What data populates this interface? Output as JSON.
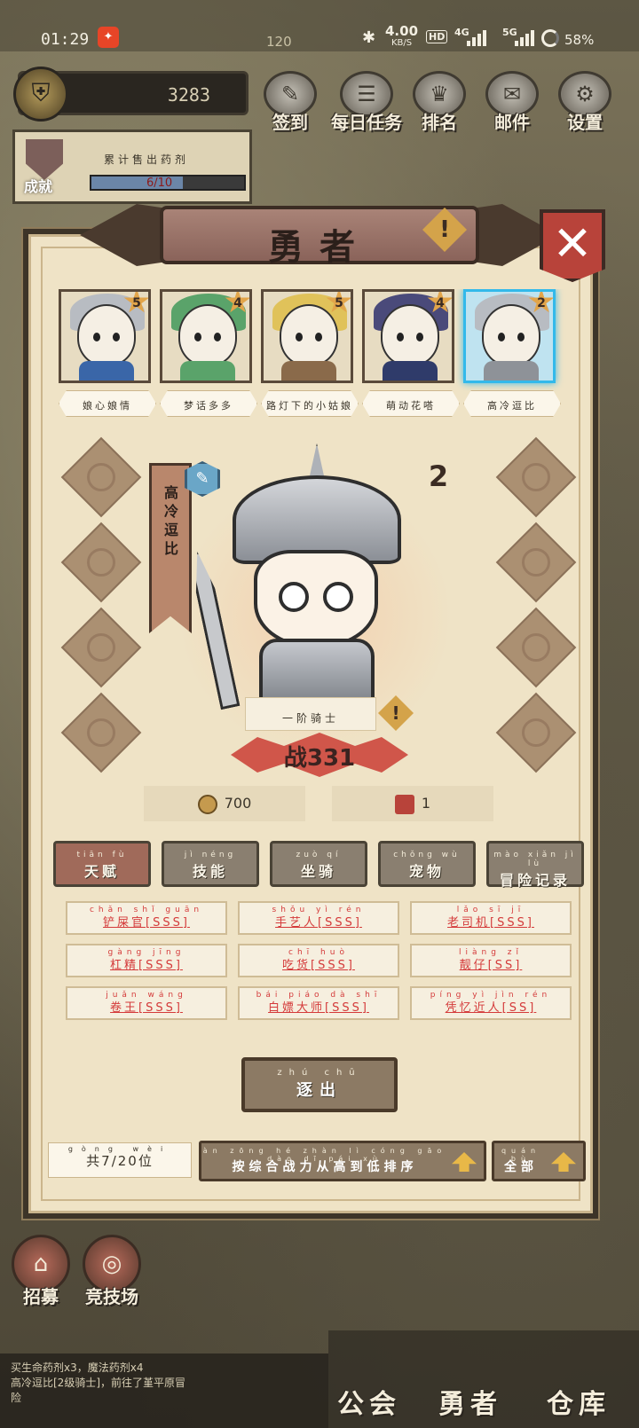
{
  "status_bar": {
    "time": "01:29",
    "app_icon_glyph": "✦",
    "resource_count": "120",
    "bluetooth_glyph": "✱",
    "net_speed": "4.00",
    "net_speed_unit": "KB/S",
    "hd_label": "HD",
    "signal_1": "4G",
    "signal_2": "5G",
    "battery_pct": "58%"
  },
  "hud": {
    "score": "3283",
    "achievement": {
      "label": "成就",
      "task_text": "累计售出药剂",
      "progress_text": "6/10",
      "progress": 0.6
    },
    "menu": [
      {
        "label": "签到",
        "icon": "quill-icon",
        "glyph": "✎"
      },
      {
        "label": "每日任务",
        "icon": "scroll-icon",
        "glyph": "☰"
      },
      {
        "label": "排名",
        "icon": "crown-icon",
        "glyph": "♛"
      },
      {
        "label": "邮件",
        "icon": "envelope-icon",
        "glyph": "✉"
      },
      {
        "label": "设置",
        "icon": "gear-icon",
        "glyph": "⚙"
      }
    ]
  },
  "panel": {
    "title": "勇者",
    "warn_glyph": "!",
    "close_glyph": "✕",
    "heroes": [
      {
        "name": "娘心娘情",
        "stars": "5",
        "hat": "#b8bcc2",
        "body": "#3a66a8",
        "selected": false
      },
      {
        "name": "梦话多多",
        "stars": "4",
        "hat": "#5aa36a",
        "body": "#5aa36a",
        "selected": false
      },
      {
        "name": "路灯下的小姑娘",
        "stars": "5",
        "hat": "#e0c25a",
        "body": "#8a6a4a",
        "selected": false
      },
      {
        "name": "萌动花嗒",
        "stars": "4",
        "hat": "#4a4a7a",
        "body": "#2f3b6a",
        "selected": false
      },
      {
        "name": "高冷逗比",
        "stars": "2",
        "hat": "#b8bcc2",
        "body": "#8e9298",
        "selected": true
      }
    ],
    "selected_hero": {
      "name_vertical": "高冷逗比",
      "rank": "2",
      "job": "一阶骑士",
      "power_prefix": "战",
      "power": "331",
      "cost_gold": "700",
      "cost_ticket": "1",
      "feather_glyph": "✎"
    },
    "tabs": [
      {
        "py": "tiān fù",
        "label": "天赋",
        "active": true
      },
      {
        "py": "jì néng",
        "label": "技能",
        "active": false
      },
      {
        "py": "zuò qí",
        "label": "坐骑",
        "active": false
      },
      {
        "py": "chǒng wù",
        "label": "宠物",
        "active": false
      },
      {
        "py": "mào xiǎn jì lù",
        "label": "冒险记录",
        "active": false
      }
    ],
    "skills": [
      {
        "py": "chǎn shǐ guān",
        "label": "铲屎官[SSS]"
      },
      {
        "py": "shǒu yì rén",
        "label": "手艺人[SSS]"
      },
      {
        "py": "lǎo sī jī",
        "label": "老司机[SSS]"
      },
      {
        "py": "gàng jīng",
        "label": "杠精[SSS]"
      },
      {
        "py": "chī huò",
        "label": "吃货[SSS]"
      },
      {
        "py": "liàng zǐ",
        "label": "靓仔[SS]"
      },
      {
        "py": "juǎn wáng",
        "label": "卷王[SSS]"
      },
      {
        "py": "bái piáo dà shī",
        "label": "白嫖大师[SSS]"
      },
      {
        "py": "píng yì jìn rén",
        "label": "凭忆近人[SS]"
      }
    ],
    "expel": {
      "py": "zhú chū",
      "label": "逐出"
    },
    "count": {
      "py": "gòng wèi",
      "label": "共7/20位"
    },
    "sort": {
      "py": "àn zōng hé zhàn lì cóng gāo dào dī pái xù",
      "label": "按综合战力从高到低排序"
    },
    "filter": {
      "py": "quán bù",
      "label": "全部"
    }
  },
  "bottom": {
    "nav": [
      {
        "label": "招募",
        "icon": "tent-icon",
        "glyph": "⌂"
      },
      {
        "label": "竞技场",
        "icon": "target-icon",
        "glyph": "◎"
      }
    ],
    "log_lines": [
      "买生命药剂x3，魔法药剂x4",
      "高冷逗比[2级骑士]，前往了堇平原冒",
      "险"
    ],
    "tabs": [
      "公会",
      "勇者",
      "仓库"
    ]
  }
}
